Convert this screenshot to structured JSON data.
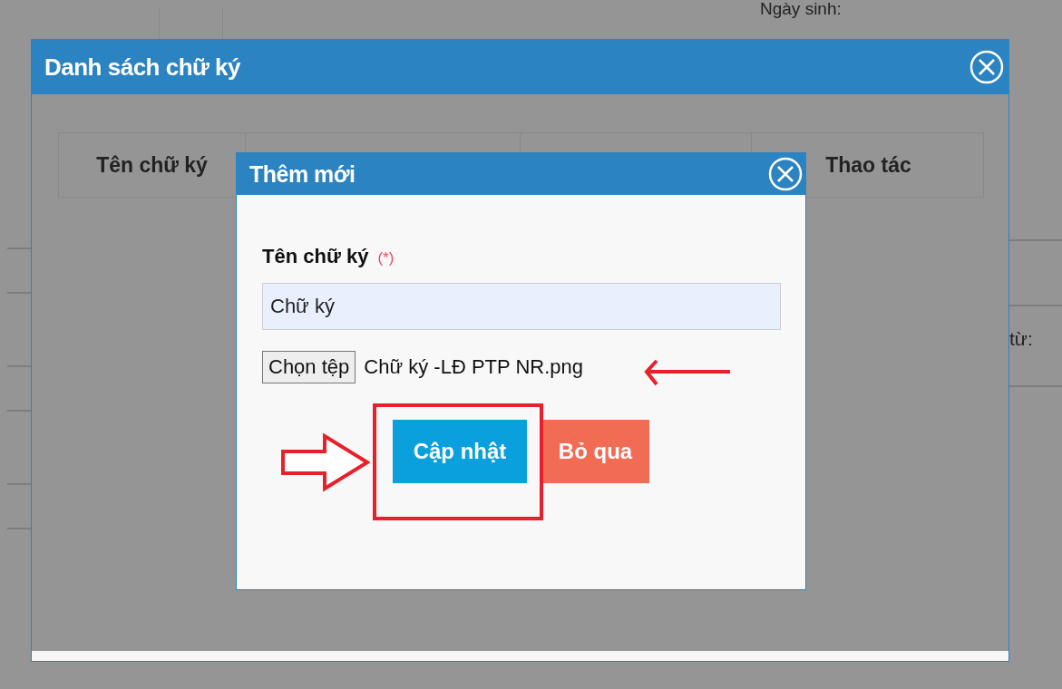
{
  "background": {
    "top_label": "Ngày sinh:",
    "side_label": "từ:"
  },
  "dialog": {
    "title": "Danh sách chữ ký",
    "columns": [
      "Tên chữ ký",
      "Thao tác"
    ]
  },
  "add_dialog": {
    "title": "Thêm mới",
    "field_label": "Tên chữ ký",
    "required_mark": "(*)",
    "name_value": "Chữ ký",
    "file_button": "Chọn tệp",
    "file_name": "Chữ ký -LĐ PTP NR.png",
    "buttons": [
      {
        "label": "Cập nhật",
        "kind": "primary"
      },
      {
        "label": "Bỏ qua",
        "kind": "danger"
      }
    ]
  }
}
